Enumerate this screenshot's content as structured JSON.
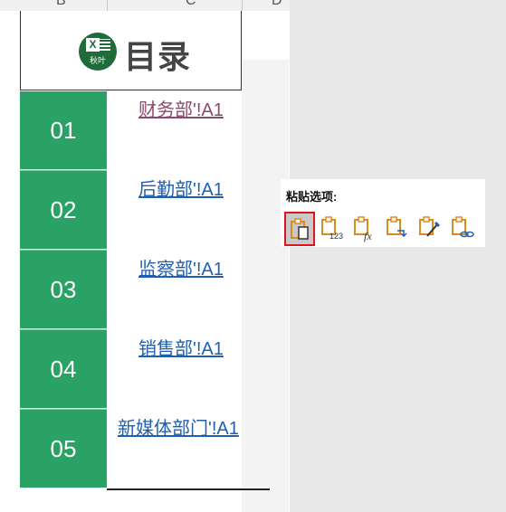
{
  "columns": {
    "b": "B",
    "c": "C",
    "d": "D"
  },
  "header": {
    "logo_text": "X",
    "logo_sub": "秋叶",
    "title": "目录"
  },
  "rows": [
    {
      "num": "01",
      "link": "财务部'!A1",
      "visited": true
    },
    {
      "num": "02",
      "link": "后勤部'!A1",
      "visited": false
    },
    {
      "num": "03",
      "link": "监察部'!A1",
      "visited": false
    },
    {
      "num": "04",
      "link": "销售部'!A1",
      "visited": false
    },
    {
      "num": "05",
      "link": "新媒体部门'!A1",
      "visited": false
    }
  ],
  "paste_options": {
    "title": "粘贴选项:",
    "buttons": [
      {
        "icon": "paste-icon",
        "selected": true
      },
      {
        "icon": "paste-values-icon",
        "sub": "123",
        "selected": false
      },
      {
        "icon": "paste-formulas-icon",
        "sub": "fx",
        "selected": false
      },
      {
        "icon": "paste-transpose-icon",
        "selected": false
      },
      {
        "icon": "paste-formatting-icon",
        "selected": false
      },
      {
        "icon": "paste-link-icon",
        "selected": false
      }
    ]
  },
  "colors": {
    "green": "#2aa165",
    "link": "#1f5fb0",
    "visited_link": "#8b4a6b",
    "icon_orange": "#e08a1e",
    "selection_border": "#e0141e"
  }
}
